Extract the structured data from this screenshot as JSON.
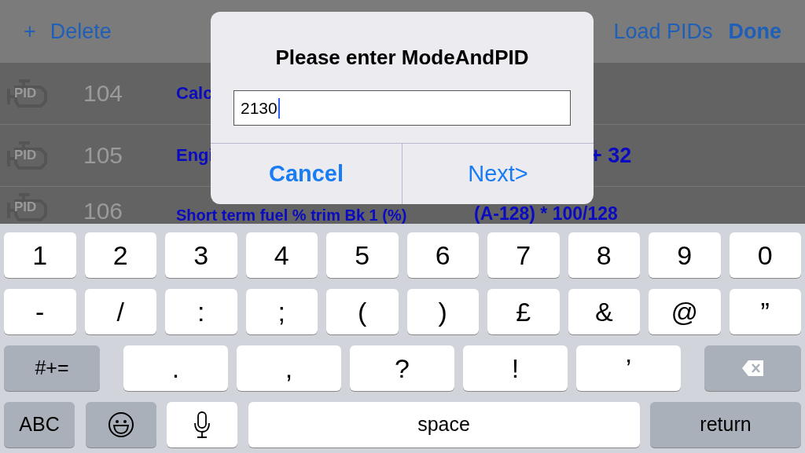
{
  "nav": {
    "add": "+",
    "delete": "Delete",
    "load": "Load PIDs",
    "done": "Done"
  },
  "rows": [
    {
      "badge": "PID",
      "number": "104",
      "name": "Calc",
      "formula": ""
    },
    {
      "badge": "PID",
      "number": "105",
      "name": "Engi",
      "formula": "+ 32"
    },
    {
      "badge": "PID",
      "number": "106",
      "name": "Short term fuel % trim Bk 1 (%)",
      "formula": "(A-128) * 100/128"
    }
  ],
  "dialog": {
    "title": "Please enter ModeAndPID",
    "value": "2130",
    "cancel": "Cancel",
    "next": "Next>"
  },
  "keyboard": [
    [
      {
        "kind": "char",
        "label": "1"
      },
      {
        "kind": "char",
        "label": "2"
      },
      {
        "kind": "char",
        "label": "3"
      },
      {
        "kind": "char",
        "label": "4"
      },
      {
        "kind": "char",
        "label": "5"
      },
      {
        "kind": "char",
        "label": "6"
      },
      {
        "kind": "char",
        "label": "7"
      },
      {
        "kind": "char",
        "label": "8"
      },
      {
        "kind": "char",
        "label": "9"
      },
      {
        "kind": "char",
        "label": "0"
      }
    ],
    [
      {
        "kind": "char",
        "label": "-"
      },
      {
        "kind": "char",
        "label": "/"
      },
      {
        "kind": "char",
        "label": ":"
      },
      {
        "kind": "char",
        "label": ";"
      },
      {
        "kind": "char",
        "label": "("
      },
      {
        "kind": "char",
        "label": ")"
      },
      {
        "kind": "char",
        "label": "£"
      },
      {
        "kind": "char",
        "label": "&"
      },
      {
        "kind": "char",
        "label": "@"
      },
      {
        "kind": "char",
        "label": "”"
      }
    ],
    [
      {
        "kind": "function",
        "label": "#+="
      },
      {
        "kind": "char",
        "label": "."
      },
      {
        "kind": "char",
        "label": ","
      },
      {
        "kind": "char",
        "label": "?"
      },
      {
        "kind": "char",
        "label": "!"
      },
      {
        "kind": "char",
        "label": "’"
      },
      {
        "kind": "backspace"
      }
    ],
    [
      {
        "kind": "function",
        "label": "ABC"
      },
      {
        "kind": "emoji"
      },
      {
        "kind": "mic"
      },
      {
        "kind": "space",
        "label": "space"
      },
      {
        "kind": "function",
        "label": "return"
      }
    ]
  ]
}
